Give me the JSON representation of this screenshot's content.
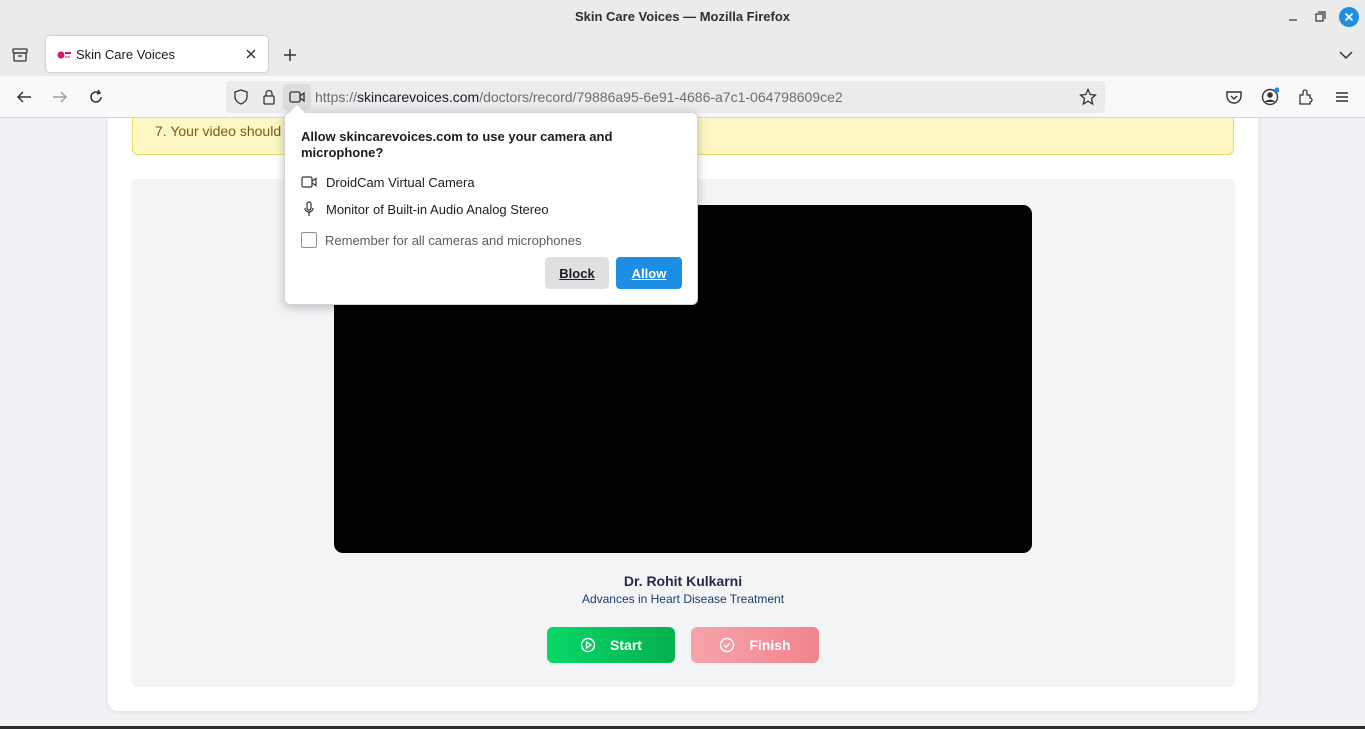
{
  "window": {
    "title": "Skin Care Voices — Mozilla Firefox"
  },
  "tab": {
    "title": "Skin Care Voices"
  },
  "urlbar": {
    "url_prefix": "https://",
    "url_host": "skincarevoices.com",
    "url_path": "/doctors/record/79886a95-6e91-4686-a7c1-064798609ce2"
  },
  "notice": {
    "text": "7. Your video should"
  },
  "doctor": {
    "name": "Dr. Rohit Kulkarni",
    "topic": "Advances in Heart Disease Treatment"
  },
  "buttons": {
    "start": "Start",
    "finish": "Finish"
  },
  "permission_popup": {
    "title": "Allow skincarevoices.com to use your camera and microphone?",
    "camera": "DroidCam Virtual Camera",
    "microphone": "Monitor of Built-in Audio Analog Stereo",
    "remember": "Remember for all cameras and microphones",
    "remember_checked": false,
    "block": "Block",
    "allow": "Allow"
  },
  "colors": {
    "allow_button": "#1d8ee3",
    "start_button": "#06c45c",
    "finish_button": "#f3959d",
    "notice_bg": "#fdf7c3"
  }
}
